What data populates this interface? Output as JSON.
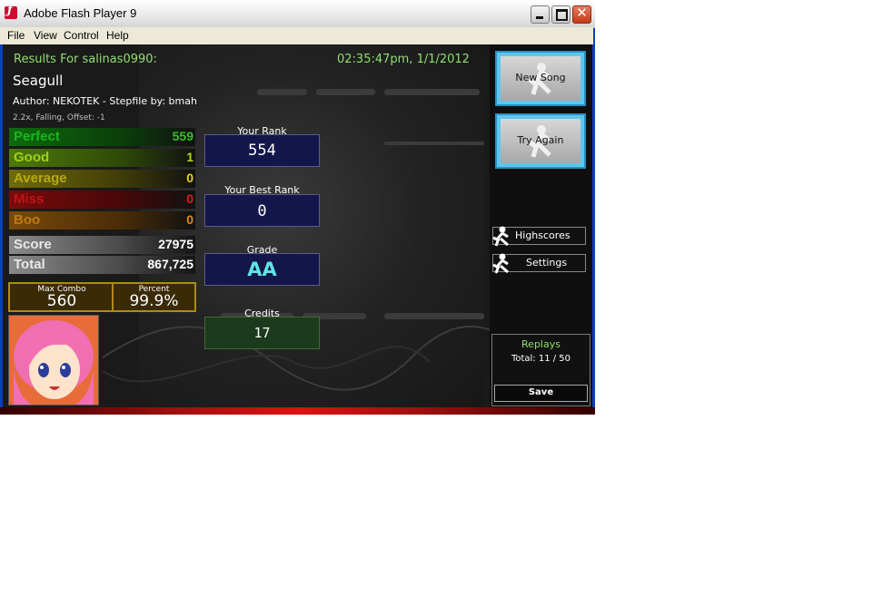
{
  "window": {
    "title": "Adobe Flash Player 9",
    "close_symbol": "✕"
  },
  "menu": [
    "File",
    "View",
    "Control",
    "Help"
  ],
  "header": {
    "results_for": "Results For salinas0990:",
    "datetime": "02:35:47pm, 1/1/2012",
    "song": "Seagull",
    "author_line": "Author: NEKOTEK  -  Stepfile by: bmah",
    "settings_line": "2.2x, Falling, Offset: -1"
  },
  "judgements": [
    {
      "label": "Perfect",
      "value": "559",
      "color": "#3bbf2a"
    },
    {
      "label": "Good",
      "value": "1",
      "color": "#b5d91c"
    },
    {
      "label": "Average",
      "value": "0",
      "color": "#e6d21a"
    },
    {
      "label": "Miss",
      "value": "0",
      "color": "#e31b1b"
    },
    {
      "label": "Boo",
      "value": "0",
      "color": "#e58a14"
    }
  ],
  "score": {
    "label": "Score",
    "value": "27975"
  },
  "total": {
    "label": "Total",
    "value": "867,725"
  },
  "combo": {
    "label": "Max Combo",
    "value": "560"
  },
  "percent": {
    "label": "Percent",
    "value": "99.9%"
  },
  "rank": {
    "caption": "Your Rank",
    "value": "554"
  },
  "best_rank": {
    "caption": "Your Best Rank",
    "value": "0"
  },
  "grade": {
    "caption": "Grade",
    "value": "AA"
  },
  "credits": {
    "caption": "Credits",
    "value": "17"
  },
  "side": {
    "new_song": "New Song",
    "try_again": "Try Again",
    "highscores": "Highscores",
    "settings": "Settings"
  },
  "replays": {
    "title": "Replays",
    "total": "Total: 11 / 50",
    "save": "Save"
  }
}
